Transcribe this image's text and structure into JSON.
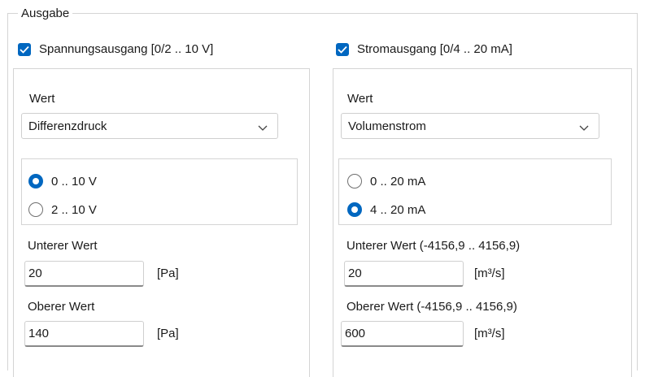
{
  "group": {
    "title": "Ausgabe"
  },
  "left": {
    "checkbox_label": "Spannungsausgang [0/2 .. 10 V]",
    "checked": true,
    "wert_label": "Wert",
    "combo_value": "Differenzdruck",
    "radios": [
      {
        "label": "0 .. 10 V",
        "selected": true
      },
      {
        "label": "2 .. 10 V",
        "selected": false
      }
    ],
    "lower_label": "Unterer Wert",
    "lower_value": "20",
    "lower_unit": "[Pa]",
    "upper_label": "Oberer Wert",
    "upper_value": "140",
    "upper_unit": "[Pa]"
  },
  "right": {
    "checkbox_label": "Stromausgang [0/4 .. 20 mA]",
    "checked": true,
    "wert_label": "Wert",
    "combo_value": "Volumenstrom",
    "radios": [
      {
        "label": "0 .. 20 mA",
        "selected": false
      },
      {
        "label": "4 .. 20 mA",
        "selected": true
      }
    ],
    "lower_label": "Unterer Wert (-4156,9 .. 4156,9)",
    "lower_value": "20",
    "lower_unit": "[m³/s]",
    "upper_label": "Oberer Wert (-4156,9 .. 4156,9)",
    "upper_value": "600",
    "upper_unit": "[m³/s]"
  },
  "colors": {
    "accent": "#0067c0",
    "border": "#d4d4d4"
  },
  "icons": {
    "check": "checkmark-icon",
    "dropdown": "chevron-down-icon"
  }
}
